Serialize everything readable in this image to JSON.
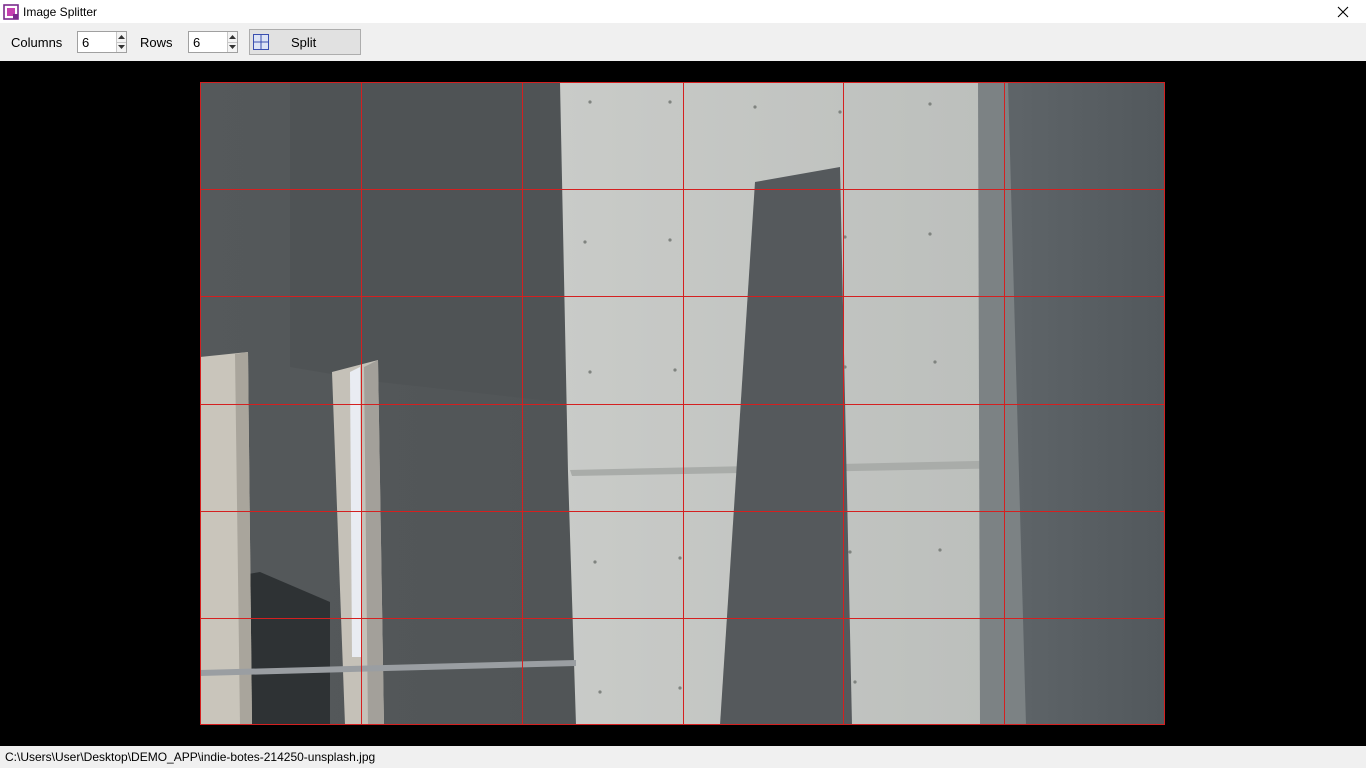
{
  "window": {
    "title": "Image Splitter",
    "icon": "image-splitter-icon",
    "close_icon": "close-icon"
  },
  "toolbar": {
    "columns_label": "Columns",
    "columns_value": "6",
    "rows_label": "Rows",
    "rows_value": "6",
    "split_label": "Split",
    "split_icon": "grid-icon"
  },
  "grid": {
    "columns": 6,
    "rows": 6,
    "line_color": "#d42020"
  },
  "status": {
    "file_path": "C:\\Users\\User\\Desktop\\DEMO_APP\\indie-botes-214250-unsplash.jpg"
  }
}
